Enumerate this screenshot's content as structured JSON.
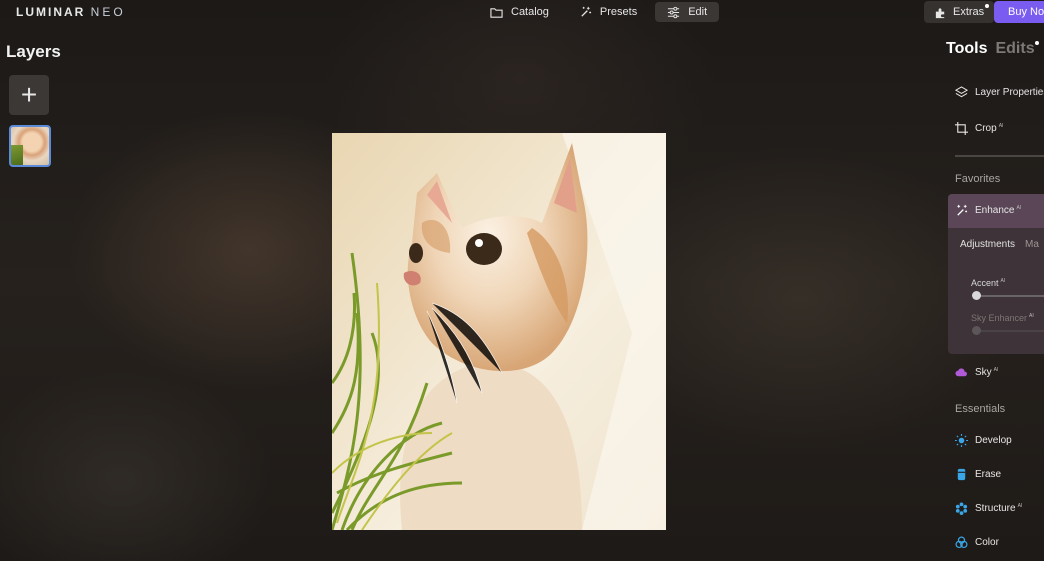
{
  "app": {
    "logo_main": "LUMINAR",
    "logo_sub": "NEO"
  },
  "topnav": {
    "catalog": "Catalog",
    "presets": "Presets",
    "edit": "Edit",
    "active": "edit"
  },
  "topright": {
    "extras": "Extras",
    "buy": "Buy Now"
  },
  "layers": {
    "title": "Layers",
    "add_label": "+"
  },
  "panel": {
    "tab_tools": "Tools",
    "tab_edits": "Edits",
    "layer_properties": "Layer Properties",
    "crop": "Crop",
    "ai_badge": "AI",
    "favorites": "Favorites",
    "enhance": "Enhance",
    "subtab_adjustments": "Adjustments",
    "subtab_second": "Ma",
    "accent_label": "Accent",
    "accent_value": 0,
    "sky_enhancer_label": "Sky Enhancer",
    "sky_enhancer_value": 0,
    "sky": "Sky",
    "essentials": "Essentials",
    "develop": "Develop",
    "erase": "Erase",
    "structure": "Structure",
    "color": "Color"
  },
  "colors": {
    "accent_purple": "#7b5cf0",
    "enhance_highlight": "#5a4656",
    "sky_icon": "#b05ad8",
    "essentials_icon": "#3aa6e8",
    "selection_border": "#5a8ad8"
  }
}
